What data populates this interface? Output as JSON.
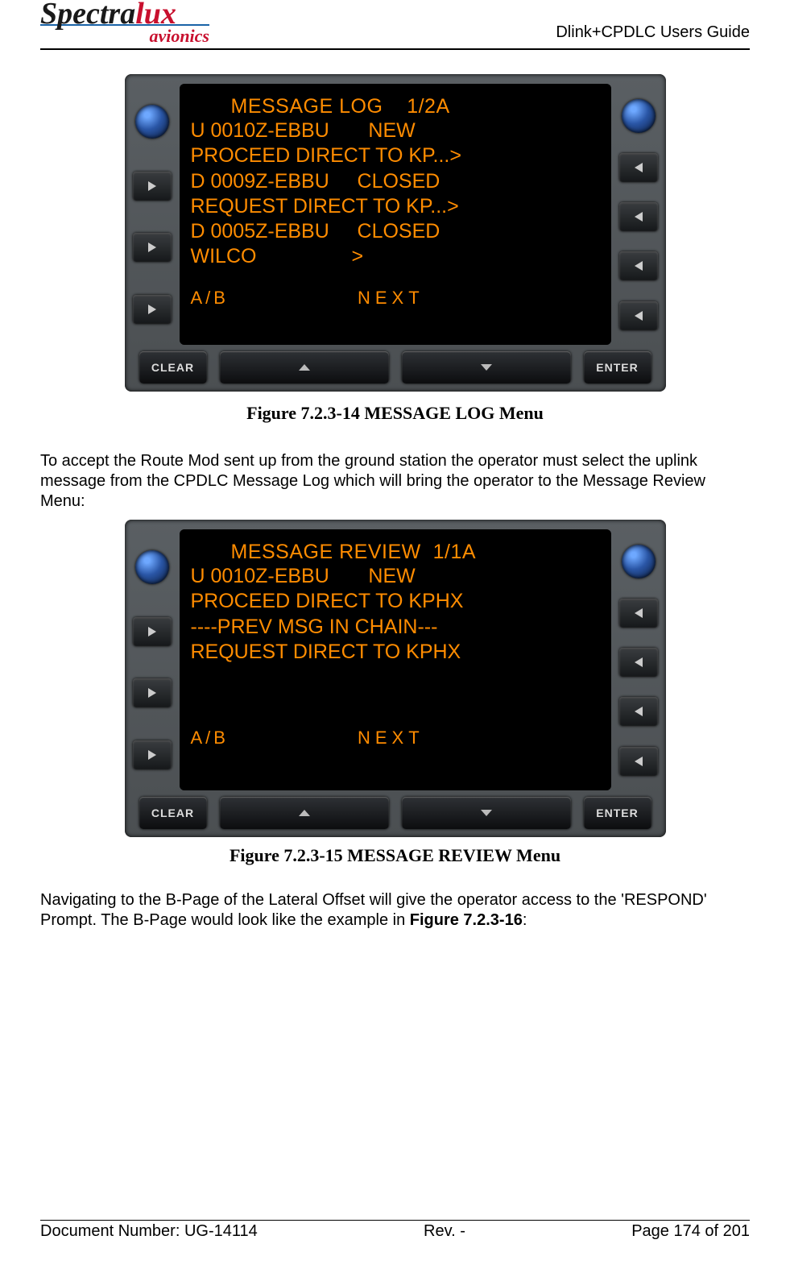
{
  "header": {
    "logo_main_a": "Spectra",
    "logo_main_b": "lux",
    "logo_sub": "avionics",
    "right": "Dlink+CPDLC Users Guide"
  },
  "fig1": {
    "title_a": "MESSAGE LOG",
    "title_b": "1/2A",
    "lines": [
      "U 0010Z-EBBU       NEW",
      "PROCEED DIRECT TO KP...>",
      "D 0009Z-EBBU     CLOSED",
      "REQUEST DIRECT TO KP...>",
      "D 0005Z-EBBU     CLOSED",
      "WILCO                 >"
    ],
    "foot_left": "A/B",
    "foot_right": "NEXT",
    "btn_clear": "CLEAR",
    "btn_enter": "ENTER",
    "caption": "Figure 7.2.3-14 MESSAGE LOG Menu"
  },
  "para1": "To accept the Route Mod sent up from the ground station the operator must select the uplink message from the CPDLC Message Log which will bring the operator to the Message Review Menu:",
  "fig2": {
    "title_a": "MESSAGE REVIEW",
    "title_b": "1/1A",
    "lines": [
      "U 0010Z-EBBU       NEW",
      "PROCEED DIRECT TO KPHX",
      "----PREV MSG IN CHAIN---",
      "REQUEST DIRECT TO KPHX"
    ],
    "foot_left": "A/B",
    "foot_right": "NEXT",
    "btn_clear": "CLEAR",
    "btn_enter": "ENTER",
    "caption": "Figure 7.2.3-15 MESSAGE REVIEW Menu"
  },
  "para2_a": "Navigating to the B-Page of the Lateral Offset will give the operator access to the 'RESPOND' Prompt. The B-Page would look like the example in ",
  "para2_b": "Figure 7.2.3-16",
  "para2_c": ":",
  "footer": {
    "left": "Document Number:  UG-14114",
    "mid": "Rev. -",
    "right": "Page 174 of 201"
  }
}
